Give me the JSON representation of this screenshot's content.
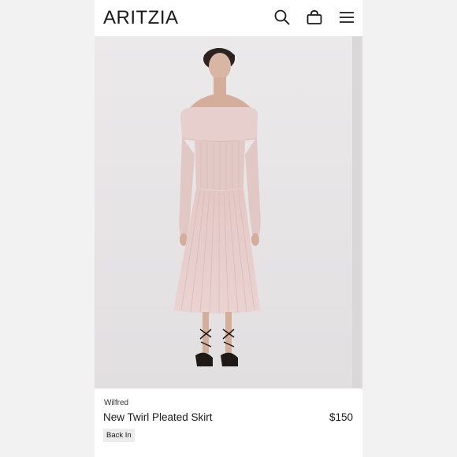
{
  "header": {
    "logo": "ARITZIA",
    "icons": [
      "search-icon",
      "bag-icon",
      "menu-icon"
    ]
  },
  "product": {
    "image_alt": "Model wearing a pale pink off-the-shoulder knit top and pleated midi skirt",
    "brand": "Wilfred",
    "name": "New Twirl Pleated Skirt",
    "price": "$150",
    "badge": "Back In"
  },
  "colors": {
    "page_background": "#f2f2f2",
    "photo_background": "#e6e4e5",
    "garment_pink": "#e7cfcd",
    "badge_background": "#ececec",
    "text": "#1a1a1a"
  }
}
